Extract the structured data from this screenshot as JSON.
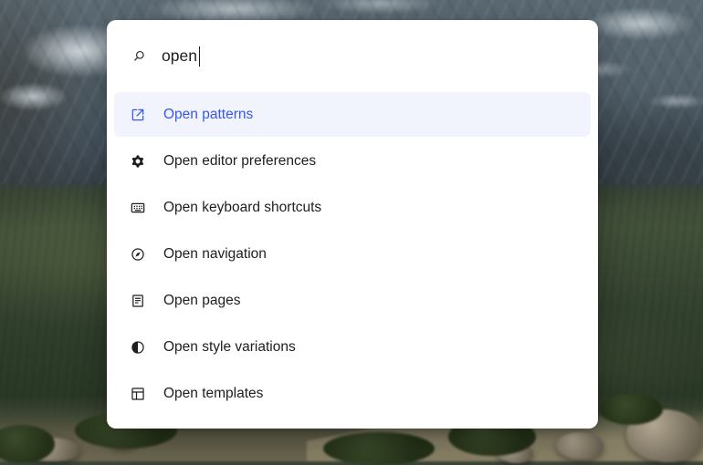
{
  "command_palette": {
    "search": {
      "icon": "search-icon",
      "value": "open",
      "placeholder": ""
    },
    "commands": [
      {
        "label": "Open patterns",
        "icon": "external-link-icon",
        "selected": true
      },
      {
        "label": "Open editor preferences",
        "icon": "gear-icon",
        "selected": false
      },
      {
        "label": "Open keyboard shortcuts",
        "icon": "keyboard-icon",
        "selected": false
      },
      {
        "label": "Open navigation",
        "icon": "compass-icon",
        "selected": false
      },
      {
        "label": "Open pages",
        "icon": "page-icon",
        "selected": false
      },
      {
        "label": "Open style variations",
        "icon": "half-circle-icon",
        "selected": false
      },
      {
        "label": "Open templates",
        "icon": "template-layout-icon",
        "selected": false
      }
    ]
  },
  "colors": {
    "accent_blue": "#3858e9",
    "selected_item_bg": "#f1f3fd",
    "item_text": "#1e1e1e",
    "palette_surface": "#ffffff",
    "mountain_slate": "#4f5d67",
    "snow": "#ccd4d9",
    "hill_green": "#36442f",
    "meadow_green": "#2c3a27",
    "rock_tan": "#8d8371"
  }
}
